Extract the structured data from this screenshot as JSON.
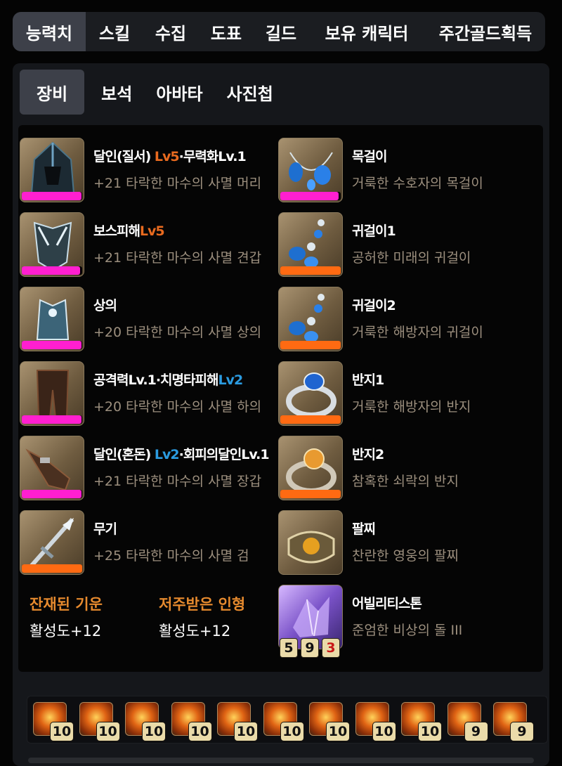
{
  "main_tabs": [
    "능력치",
    "스킬",
    "수집",
    "도표",
    "길드",
    "보유 캐릭터",
    "주간골드획득"
  ],
  "sub_tabs": [
    "장비",
    "보석",
    "아바타",
    "사진첩"
  ],
  "colors": {
    "pink": "#ff1fd0",
    "orange": "#ff6a12",
    "level_orange": "#e86a1f",
    "level_blue": "#2b9be0",
    "effect_title": "#e68a2e"
  },
  "equipment_left": [
    {
      "icon": "helmet-icon",
      "name_parts": [
        "달인(질서) ",
        "Lv5",
        "·무력화Lv.1"
      ],
      "level_color": "orange",
      "sub": "+21 타락한 마수의 사멸 머리",
      "quality": 0.99,
      "quality_color": "pink"
    },
    {
      "icon": "shoulder-icon",
      "name_parts": [
        "보스피해",
        "Lv5",
        ""
      ],
      "level_color": "orange",
      "sub": "+21 타락한 마수의 사멸 견갑",
      "quality": 0.96,
      "quality_color": "pink"
    },
    {
      "icon": "chest-armor-icon",
      "name_parts": [
        "상의",
        "",
        ""
      ],
      "level_color": "orange",
      "sub": "+20 타락한 마수의 사멸 상의",
      "quality": 0.99,
      "quality_color": "pink"
    },
    {
      "icon": "pants-icon",
      "name_parts": [
        "공격력Lv.1·치명타피해",
        "Lv2",
        ""
      ],
      "level_color": "blue",
      "sub": "+20 타락한 마수의 사멸 하의",
      "quality": 0.99,
      "quality_color": "pink"
    },
    {
      "icon": "gloves-icon",
      "name_parts": [
        "달인(혼돈) ",
        "Lv2",
        "·회피의달인Lv.1"
      ],
      "level_color": "blue",
      "sub": "+21 타락한 마수의 사멸 장갑",
      "quality": 0.99,
      "quality_color": "pink"
    },
    {
      "icon": "weapon-icon",
      "name_parts": [
        "무기",
        "",
        ""
      ],
      "level_color": "orange",
      "sub": "+25 타락한 마수의 사멸 검",
      "quality": 1.0,
      "quality_color": "orange"
    }
  ],
  "equipment_right": [
    {
      "icon": "necklace-icon",
      "name": "목걸이",
      "sub": "거룩한 수호자의 목걸이",
      "quality": 0.96,
      "quality_color": "pink"
    },
    {
      "icon": "earring-icon",
      "name": "귀걸이1",
      "sub": "공허한 미래의 귀걸이",
      "quality": 1.0,
      "quality_color": "orange"
    },
    {
      "icon": "earring-icon",
      "name": "귀걸이2",
      "sub": "거룩한 해방자의 귀걸이",
      "quality": 1.0,
      "quality_color": "orange"
    },
    {
      "icon": "ring-icon",
      "name": "반지1",
      "sub": "거룩한 해방자의 반지",
      "quality": 1.0,
      "quality_color": "orange"
    },
    {
      "icon": "ring-icon",
      "name": "반지2",
      "sub": "참혹한 쇠락의 반지",
      "quality": 1.0,
      "quality_color": "orange"
    },
    {
      "icon": "bracelet-icon",
      "name": "팔찌",
      "sub": "찬란한 영웅의 팔찌",
      "quality": null,
      "quality_color": ""
    }
  ],
  "ability_stone": {
    "icon": "ability-stone-icon",
    "name": "어빌리티스톤",
    "sub": "준엄한 비상의 돌 III",
    "levels": [
      "5",
      "9",
      "3"
    ]
  },
  "effects": [
    {
      "title": "잔재된 기운",
      "value": "활성도+12"
    },
    {
      "title": "저주받은 인형",
      "value": "활성도+12"
    }
  ],
  "gems": [
    "10",
    "10",
    "10",
    "10",
    "10",
    "10",
    "10",
    "10",
    "10",
    "9",
    "9"
  ]
}
